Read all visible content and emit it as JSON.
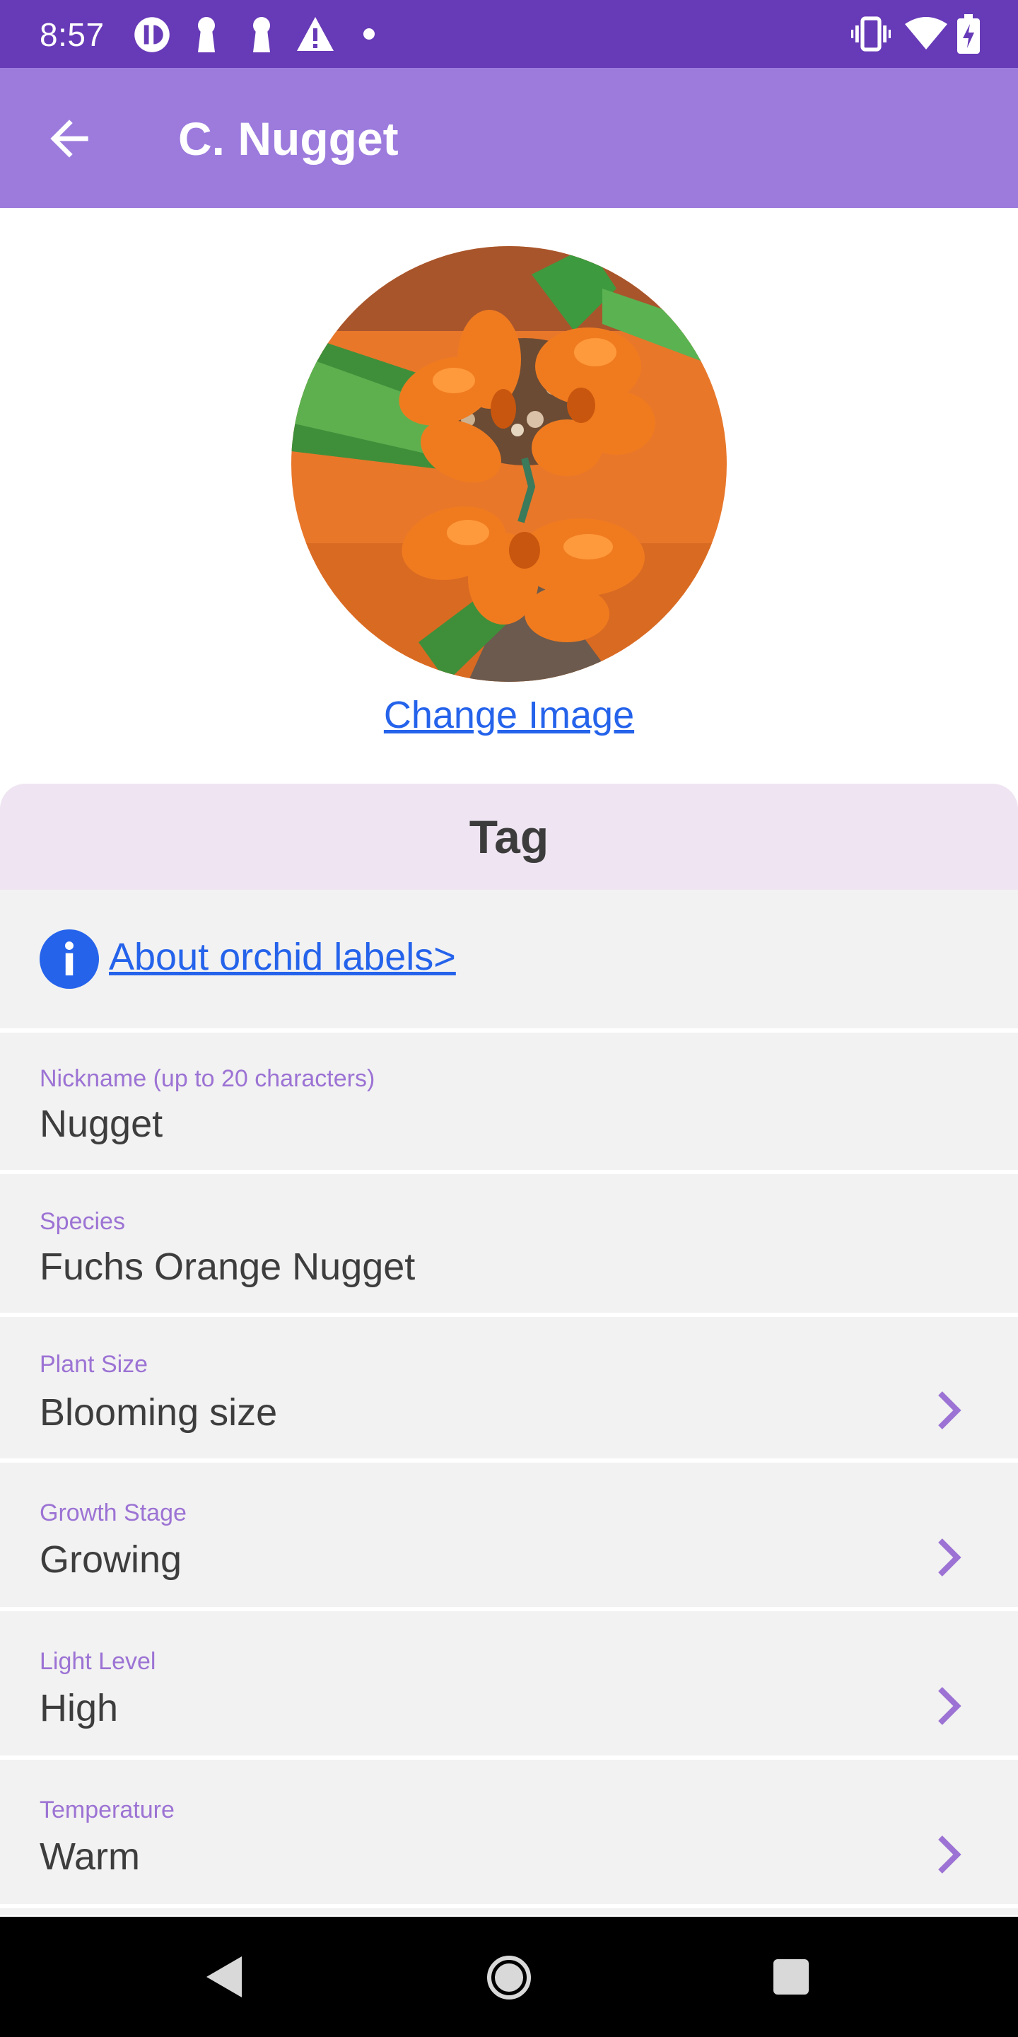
{
  "status_bar": {
    "time": "8:57",
    "icons": [
      "app-notification-icon",
      "key-icon",
      "key-icon",
      "warning-icon",
      "dot-icon",
      "vibrate-icon",
      "wifi-icon",
      "battery-charging-icon"
    ]
  },
  "app_bar": {
    "back_icon": "arrow-back-icon",
    "title": "C. Nugget"
  },
  "photo": {
    "change_label": "Change Image"
  },
  "tag_card": {
    "header": "Tag",
    "about_link": "About orchid labels>",
    "fields": [
      {
        "label": "Nickname (up to 20 characters)",
        "value": "Nugget",
        "has_chevron": false
      },
      {
        "label": "Species",
        "value": "Fuchs Orange Nugget",
        "has_chevron": false
      },
      {
        "label": "Plant Size",
        "value": "Blooming size",
        "has_chevron": true
      },
      {
        "label": "Growth Stage",
        "value": "Growing",
        "has_chevron": true
      },
      {
        "label": "Light Level",
        "value": "High",
        "has_chevron": true
      },
      {
        "label": "Temperature",
        "value": "Warm",
        "has_chevron": true
      }
    ]
  },
  "colors": {
    "status_bar": "#673ab7",
    "app_bar": "#9c7bdd",
    "link": "#2563eb",
    "field_label": "#9c73d4",
    "card_header": "#efe5f2",
    "card_body": "#f2f2f2"
  }
}
